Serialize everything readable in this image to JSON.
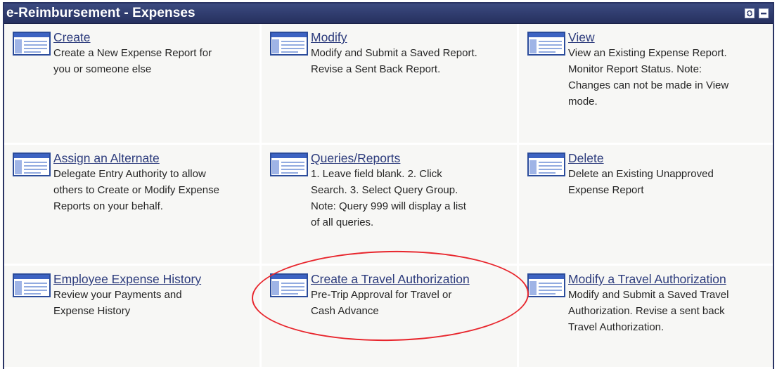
{
  "header": {
    "title": "e-Reimbursement - Expenses"
  },
  "icons": {
    "refresh": "refresh-icon",
    "minimize": "minimize-icon",
    "item": "expense-page-icon"
  },
  "colors": {
    "header": "#2f3b6e",
    "link": "#2c3b7c",
    "annotation": "#e8262d"
  },
  "items": [
    {
      "label": "Create",
      "description": "Create a New Expense Report for\nyou or someone else"
    },
    {
      "label": "Modify",
      "description": "Modify and Submit a Saved Report.\nRevise a Sent Back Report."
    },
    {
      "label": "View",
      "description": "View an Existing Expense Report.\nMonitor Report Status. Note:\nChanges can not be made in View\nmode."
    },
    {
      "label": "Assign an Alternate",
      "description": "Delegate Entry Authority to allow\nothers to Create or Modify Expense\nReports on your behalf."
    },
    {
      "label": "Queries/Reports",
      "description": "1. Leave field blank. 2. Click\nSearch. 3. Select Query Group.\nNote: Query 999 will display a list\nof all queries."
    },
    {
      "label": "Delete",
      "description": "Delete an Existing Unapproved\nExpense Report"
    },
    {
      "label": "Employee Expense History",
      "description": "Review your Payments and\nExpense History"
    },
    {
      "label": "Create a Travel Authorization",
      "description": "Pre-Trip Approval for Travel or\nCash Advance"
    },
    {
      "label": "Modify a Travel Authorization",
      "description": "Modify and Submit a Saved Travel\nAuthorization. Revise a sent back\nTravel Authorization."
    }
  ]
}
